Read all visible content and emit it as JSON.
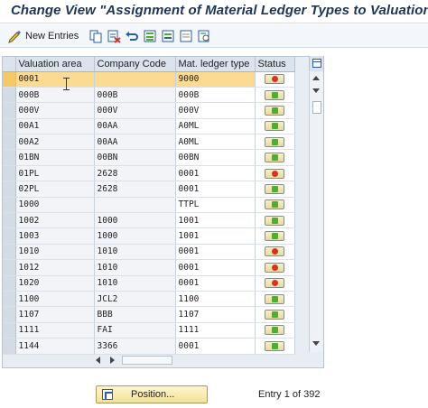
{
  "title": "Change View \"Assignment of Material Ledger Types to Valuation",
  "toolbar": {
    "new_entries_label": "New Entries"
  },
  "table": {
    "headers": [
      "Valuation area",
      "Company Code",
      "Mat. ledger type",
      "Status"
    ],
    "rows": [
      {
        "va": "0001",
        "cc": "",
        "ml": "9000",
        "status": "red"
      },
      {
        "va": "000B",
        "cc": "000B",
        "ml": "000B",
        "status": "green"
      },
      {
        "va": "000V",
        "cc": "000V",
        "ml": "000V",
        "status": "green"
      },
      {
        "va": "00A1",
        "cc": "00AA",
        "ml": "A0ML",
        "status": "green"
      },
      {
        "va": "00A2",
        "cc": "00AA",
        "ml": "A0ML",
        "status": "green"
      },
      {
        "va": "01BN",
        "cc": "00BN",
        "ml": "00BN",
        "status": "green"
      },
      {
        "va": "01PL",
        "cc": "2628",
        "ml": "0001",
        "status": "red"
      },
      {
        "va": "02PL",
        "cc": "2628",
        "ml": "0001",
        "status": "green"
      },
      {
        "va": "1000",
        "cc": "",
        "ml": "TTPL",
        "status": "green"
      },
      {
        "va": "1002",
        "cc": "1000",
        "ml": "1001",
        "status": "green"
      },
      {
        "va": "1003",
        "cc": "1000",
        "ml": "1001",
        "status": "green"
      },
      {
        "va": "1010",
        "cc": "1010",
        "ml": "0001",
        "status": "red"
      },
      {
        "va": "1012",
        "cc": "1010",
        "ml": "0001",
        "status": "red"
      },
      {
        "va": "1020",
        "cc": "1010",
        "ml": "0001",
        "status": "red"
      },
      {
        "va": "1100",
        "cc": "JCL2",
        "ml": "1100",
        "status": "green"
      },
      {
        "va": "1107",
        "cc": "BBB",
        "ml": "1107",
        "status": "green"
      },
      {
        "va": "1111",
        "cc": "FAI",
        "ml": "1111",
        "status": "green"
      },
      {
        "va": "1144",
        "cc": "3366",
        "ml": "0001",
        "status": "green"
      }
    ]
  },
  "footer": {
    "position_button_label": "Position...",
    "entry_info": "Entry 1 of 392"
  }
}
